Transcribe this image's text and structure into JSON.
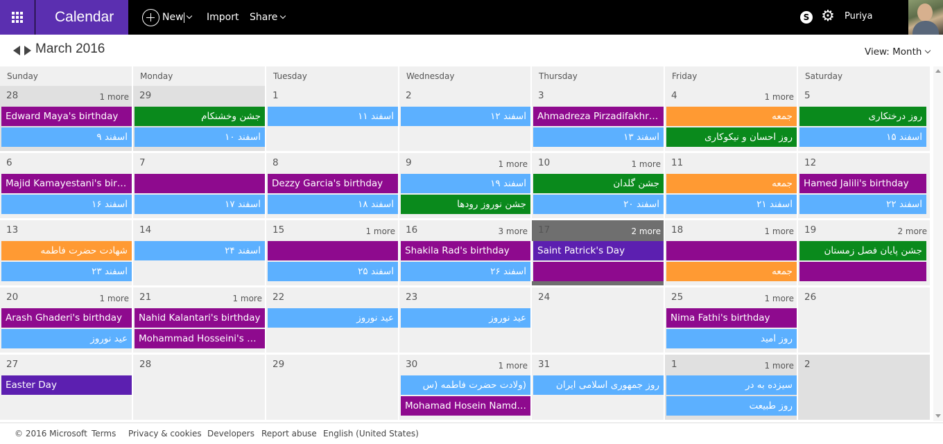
{
  "app": {
    "title": "Calendar"
  },
  "toolbar": {
    "new_label": "New",
    "import_label": "Import",
    "share_label": "Share",
    "user_name": "Puriya"
  },
  "header": {
    "month_title": "March 2016",
    "view_label": "View: Month"
  },
  "colors": {
    "purple": "#8e0a8e",
    "blue": "#5cb0ff",
    "green": "#0a8a1c",
    "orange": "#ff9a33",
    "indigo": "#5c1fb0",
    "brand": "#5b2fb0"
  },
  "weekdays": [
    "Sunday",
    "Monday",
    "Tuesday",
    "Wednesday",
    "Thursday",
    "Friday",
    "Saturday"
  ],
  "weeks": [
    [
      {
        "day": "28",
        "more": "1 more",
        "other": true,
        "events": [
          {
            "text": "Edward Maya's birthday",
            "color": "purple"
          },
          {
            "text": "اسفند ۹",
            "color": "blue"
          }
        ]
      },
      {
        "day": "29",
        "more": "",
        "other": true,
        "events": [
          {
            "text": "جشن وخشنکام",
            "color": "green"
          },
          {
            "text": "اسفند ۱۰",
            "color": "blue"
          }
        ]
      },
      {
        "day": "1",
        "more": "",
        "events": [
          {
            "text": "اسفند ۱۱",
            "color": "blue"
          }
        ]
      },
      {
        "day": "2",
        "more": "",
        "events": [
          {
            "text": "اسفند ۱۲",
            "color": "blue"
          }
        ]
      },
      {
        "day": "3",
        "more": "",
        "events": [
          {
            "text": "Ahmadreza Pirzadifakhr's birthday",
            "color": "purple"
          },
          {
            "text": "اسفند ۱۳",
            "color": "blue"
          }
        ]
      },
      {
        "day": "4",
        "more": "1 more",
        "events": [
          {
            "text": "جمعه",
            "color": "orange"
          },
          {
            "text": "روز احسان و نیکوکاری",
            "color": "green"
          }
        ]
      },
      {
        "day": "5",
        "more": "",
        "events": [
          {
            "text": "روز درختکاری",
            "color": "green"
          },
          {
            "text": "اسفند ۱۵",
            "color": "blue"
          }
        ]
      }
    ],
    [
      {
        "day": "6",
        "more": "",
        "events": [
          {
            "text": "Majid Kamayestani's birthday",
            "color": "purple"
          },
          {
            "text": "اسفند ۱۶",
            "color": "blue"
          }
        ]
      },
      {
        "day": "7",
        "more": "",
        "events": [
          {
            "text": "",
            "color": "purple"
          },
          {
            "text": "اسفند ۱۷",
            "color": "blue"
          }
        ]
      },
      {
        "day": "8",
        "more": "",
        "events": [
          {
            "text": "Dezzy Garcia's birthday",
            "color": "purple"
          },
          {
            "text": "اسفند ۱۸",
            "color": "blue"
          }
        ]
      },
      {
        "day": "9",
        "more": "1 more",
        "events": [
          {
            "text": "اسفند ۱۹",
            "color": "blue"
          },
          {
            "text": "جشن نوروز رودها",
            "color": "green"
          }
        ]
      },
      {
        "day": "10",
        "more": "1 more",
        "events": [
          {
            "text": "جشن گلدان",
            "color": "green"
          },
          {
            "text": "اسفند ۲۰",
            "color": "blue"
          }
        ]
      },
      {
        "day": "11",
        "more": "",
        "events": [
          {
            "text": "جمعه",
            "color": "orange"
          },
          {
            "text": "اسفند ۲۱",
            "color": "blue"
          }
        ]
      },
      {
        "day": "12",
        "more": "",
        "events": [
          {
            "text": "Hamed Jalili's birthday",
            "color": "purple"
          },
          {
            "text": "اسفند ۲۲",
            "color": "blue"
          }
        ]
      }
    ],
    [
      {
        "day": "13",
        "more": "",
        "events": [
          {
            "text": "شهادت حضرت فاطمه",
            "color": "orange"
          },
          {
            "text": "اسفند ۲۳",
            "color": "blue"
          }
        ]
      },
      {
        "day": "14",
        "more": "",
        "events": [
          {
            "text": "اسفند ۲۴",
            "color": "blue"
          }
        ]
      },
      {
        "day": "15",
        "more": "1 more",
        "events": [
          {
            "text": "",
            "color": "purple"
          },
          {
            "text": "اسفند ۲۵",
            "color": "blue"
          }
        ]
      },
      {
        "day": "16",
        "more": "3 more",
        "events": [
          {
            "text": "Shakila Rad's birthday",
            "color": "purple"
          },
          {
            "text": "اسفند ۲۶",
            "color": "blue"
          }
        ]
      },
      {
        "day": "17",
        "more": "2 more",
        "today": true,
        "events": [
          {
            "text": "Saint Patrick's Day",
            "color": "indigo"
          },
          {
            "text": "",
            "color": "purple"
          }
        ]
      },
      {
        "day": "18",
        "more": "1 more",
        "events": [
          {
            "text": "",
            "color": "purple"
          },
          {
            "text": "جمعه",
            "color": "orange"
          }
        ]
      },
      {
        "day": "19",
        "more": "2 more",
        "events": [
          {
            "text": "جشن پایان فصل زمستان",
            "color": "green"
          },
          {
            "text": "",
            "color": "purple"
          }
        ]
      }
    ],
    [
      {
        "day": "20",
        "more": "1 more",
        "events": [
          {
            "text": "Arash Ghaderi's birthday",
            "color": "purple"
          },
          {
            "text": "عید نوروز",
            "color": "blue"
          }
        ]
      },
      {
        "day": "21",
        "more": "1 more",
        "events": [
          {
            "text": "Nahid Kalantari's birthday",
            "color": "purple"
          },
          {
            "text": "Mohammad Hosseini's birthday",
            "color": "purple"
          }
        ]
      },
      {
        "day": "22",
        "more": "",
        "events": [
          {
            "text": "عید نوروز",
            "color": "blue"
          }
        ]
      },
      {
        "day": "23",
        "more": "",
        "events": [
          {
            "text": "عید نوروز",
            "color": "blue"
          }
        ]
      },
      {
        "day": "24",
        "more": "",
        "events": []
      },
      {
        "day": "25",
        "more": "1 more",
        "events": [
          {
            "text": "Nima Fathi's birthday",
            "color": "purple"
          },
          {
            "text": "روز امید",
            "color": "blue"
          }
        ]
      },
      {
        "day": "26",
        "more": "",
        "events": []
      }
    ],
    [
      {
        "day": "27",
        "more": "",
        "events": [
          {
            "text": "Easter Day",
            "color": "indigo"
          }
        ]
      },
      {
        "day": "28",
        "more": "",
        "events": []
      },
      {
        "day": "29",
        "more": "",
        "events": []
      },
      {
        "day": "30",
        "more": "1 more",
        "events": [
          {
            "text": "(ولادت حضرت فاطمه (س",
            "color": "blue"
          },
          {
            "text": "Mohamad Hosein Namdar's birthday",
            "color": "purple"
          }
        ]
      },
      {
        "day": "31",
        "more": "",
        "events": [
          {
            "text": "روز جمهوری اسلامی ایران",
            "color": "blue"
          }
        ]
      },
      {
        "day": "1",
        "more": "1 more",
        "other": true,
        "events": [
          {
            "text": "سیزده به در",
            "color": "blue"
          },
          {
            "text": "روز طبیعت",
            "color": "blue"
          }
        ]
      },
      {
        "day": "2",
        "more": "",
        "other": true,
        "events": []
      }
    ]
  ],
  "footer": {
    "copyright": "© 2016 Microsoft",
    "terms": "Terms",
    "privacy": "Privacy & cookies",
    "developers": "Developers",
    "report": "Report abuse",
    "language": "English (United States)"
  }
}
